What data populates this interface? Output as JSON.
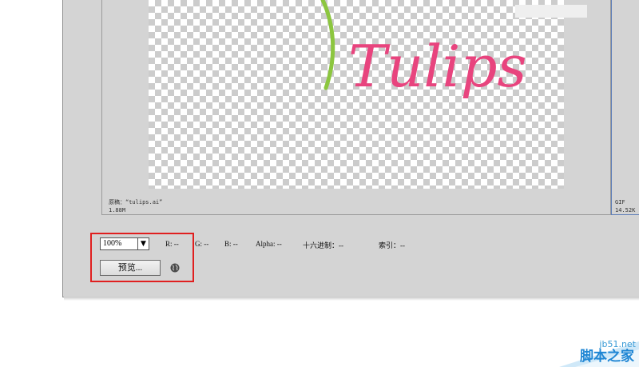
{
  "original_panel": {
    "file_label": "原稿：“tulips.ai”",
    "file_size": "1.88M",
    "artwork_text": "Tulips"
  },
  "optimized_panel": {
    "format": "GIF",
    "size": "14.52K"
  },
  "toolbar": {
    "zoom_value": "100%",
    "r_readout": "R: --",
    "g_readout": "G: --",
    "b_readout": "B: --",
    "alpha_readout": "Alpha: --",
    "hex_readout": "十六进制：--",
    "index_readout": "索引：--",
    "preview_button": "预览..."
  },
  "watermark": {
    "url": "jb51.net",
    "brand": "脚本之家"
  },
  "colors": {
    "tulips_pink": "#e8447e",
    "stem_green": "#8cc63f",
    "highlight_red": "#e01f1f",
    "watermark_blue": "#1f86d4"
  }
}
